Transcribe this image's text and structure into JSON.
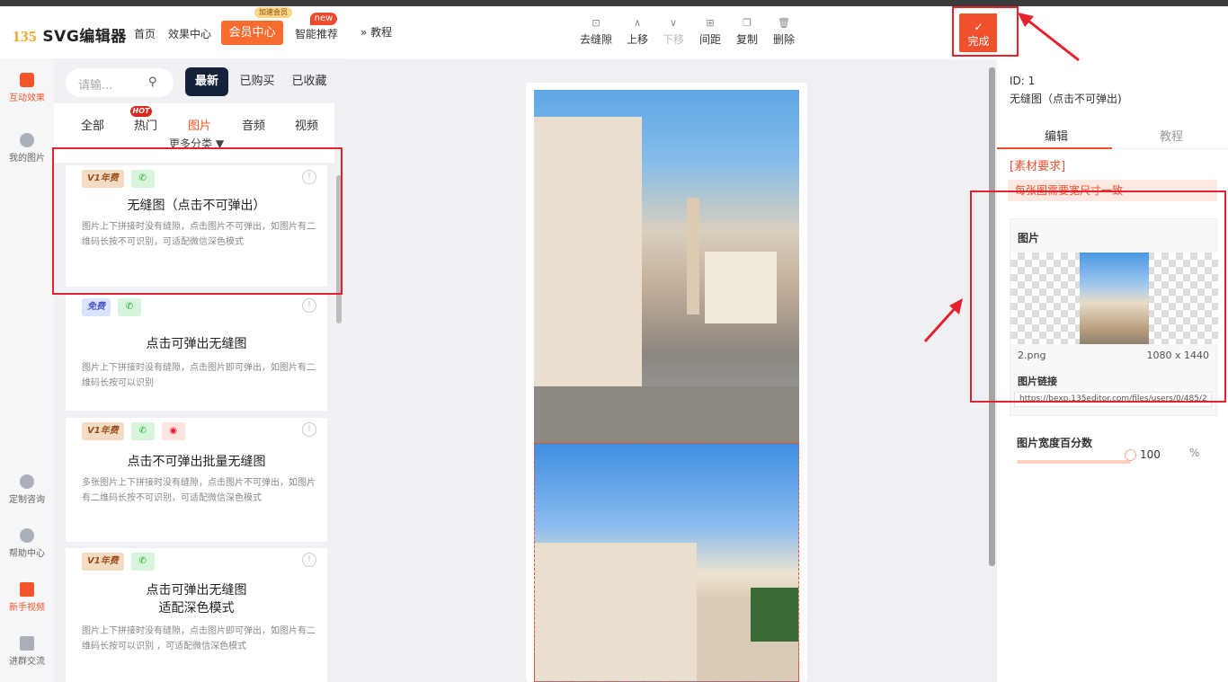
{
  "header": {
    "logo_num": "135",
    "logo_text": "SVG编辑器",
    "nav": [
      "首页",
      "效果中心"
    ],
    "vip_button": "会员中心",
    "vip_tag": "加速会员",
    "new_tag": "new",
    "smart": "智能推荐"
  },
  "leftnav": [
    {
      "label": "互动效果",
      "icon": "cube-icon"
    },
    {
      "label": "我的图片",
      "icon": "cloud-icon"
    },
    {
      "label": "定制咨询",
      "icon": "headset-icon"
    },
    {
      "label": "帮助中心",
      "icon": "help-icon"
    },
    {
      "label": "新手视频",
      "icon": "video-icon"
    },
    {
      "label": "进群交流",
      "icon": "doc-icon"
    }
  ],
  "panel": {
    "search_placeholder": "请输...",
    "tabs": [
      "最新",
      "已购买",
      "已收藏"
    ],
    "categories": [
      "全部",
      "热门",
      "图片",
      "音频",
      "视频"
    ],
    "hot_tag": "HOT",
    "more": "更多分类 ▼",
    "cards": [
      {
        "badges": [
          "V1年费",
          "wechat"
        ],
        "title": "无缝图（点击不可弹出）",
        "desc": "图片上下拼接时没有缝隙，点击图片不可弹出，如图片有二维码长按不可识别，可适配微信深色模式"
      },
      {
        "badges": [
          "免费",
          "wechat"
        ],
        "title": "点击可弹出无缝图",
        "desc": "图片上下拼接时没有缝隙，点击图片即可弹出，如图片有二维码长按可以识别"
      },
      {
        "badges": [
          "V1年费",
          "wechat",
          "weibo"
        ],
        "title": "点击不可弹出批量无缝图",
        "desc": "多张图片上下拼接时没有缝隙，点击图片不可弹出，如图片有二维码长按不可识别，可适配微信深色模式"
      },
      {
        "badges": [
          "V1年费",
          "wechat"
        ],
        "title": "点击可弹出无缝图\n适配深色模式",
        "desc": "图片上下拼接时没有缝隙，点击图片即可弹出，如图片有二维码长按可以识别 ，可适配微信深色模式"
      }
    ]
  },
  "canvas": {
    "crumb": "» 教程",
    "tools": [
      "去缝隙",
      "上移",
      "下移",
      "间距",
      "复制",
      "删除"
    ],
    "done": "完成"
  },
  "props": {
    "id": "ID: 1",
    "name": "无缝图（点击不可弹出)",
    "tabs": [
      "编辑",
      "教程"
    ],
    "req_title": "[素材要求]",
    "req_text": "每张图需要宽尺寸一致",
    "img_label": "图片",
    "file_name": "2.png",
    "file_size": "1080 x 1440",
    "link_label": "图片链接",
    "link": "https://bexp.135editor.com/files/users/0/485/2",
    "width_label": "图片宽度百分数",
    "width_value": "100",
    "pct": "%"
  }
}
